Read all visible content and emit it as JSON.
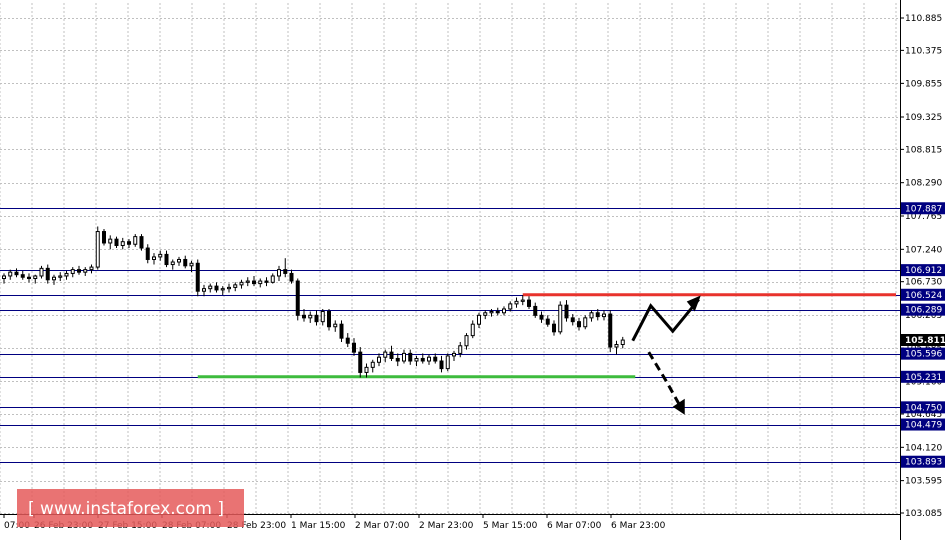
{
  "chart_data": {
    "type": "candlestick",
    "symbol_hidden": true,
    "y_axis": {
      "ticks": [
        "110.885",
        "110.375",
        "109.855",
        "109.325",
        "108.815",
        "108.290",
        "107.765",
        "107.240",
        "106.730",
        "106.205",
        "105.685",
        "105.160",
        "104.645",
        "104.120",
        "103.595",
        "103.085"
      ],
      "tick_values": [
        110.885,
        110.375,
        109.855,
        109.325,
        108.815,
        108.29,
        107.765,
        107.24,
        106.73,
        106.205,
        105.685,
        105.16,
        104.645,
        104.12,
        103.595,
        103.085
      ],
      "ylim": [
        103.085,
        110.885
      ],
      "position": "right"
    },
    "x_axis": {
      "labels": [
        "07:00",
        "26 Feb 23:00",
        "27 Feb 15:00",
        "28 Feb 07:00",
        "28 Feb 23:00",
        "1 Mar 15:00",
        "2 Mar 07:00",
        "2 Mar 23:00",
        "5 Mar 15:00",
        "6 Mar 07:00",
        "6 Mar 23:00"
      ]
    },
    "grid": true,
    "levels": [
      {
        "label": "107.887",
        "value": 107.887,
        "color": "#000080",
        "box_color": "#000080"
      },
      {
        "label": "106.912",
        "value": 106.912,
        "color": "#000080",
        "box_color": "#000080"
      },
      {
        "label": "106.524",
        "value": 106.524,
        "color": "#000080",
        "box_color": "#000080"
      },
      {
        "label": "106.289",
        "value": 106.289,
        "color": "#000080",
        "box_color": "#000080"
      },
      {
        "label": "105.596",
        "value": 105.596,
        "color": "#000080",
        "box_color": "#000080"
      },
      {
        "label": "105.231",
        "value": 105.231,
        "color": "#000080",
        "box_color": "#000080"
      },
      {
        "label": "104.750",
        "value": 104.75,
        "color": "#000080",
        "box_color": "#000080"
      },
      {
        "label": "104.479",
        "value": 104.479,
        "color": "#000080",
        "box_color": "#000080"
      },
      {
        "label": "103.893",
        "value": 103.893,
        "color": "#000080",
        "box_color": "#000080"
      }
    ],
    "current_price": {
      "label": "105.811",
      "value": 105.811,
      "box_color": "#000000"
    },
    "resistance_line": {
      "value": 106.524,
      "color": "#e8322c",
      "x_from_bar": 83,
      "x_to_end": true
    },
    "support_line": {
      "value": 105.231,
      "color": "#3dbb3d",
      "x_from_bar": 31,
      "x_to_bar": 101
    },
    "scenario_up": [
      [
        105.8,
        106.35,
        105.95,
        106.45
      ]
    ],
    "scenario_down": [
      [
        105.62,
        105.15,
        104.79
      ]
    ],
    "ohlc": [
      [
        106.78,
        106.86,
        106.7,
        106.82
      ],
      [
        106.82,
        106.92,
        106.76,
        106.88
      ],
      [
        106.88,
        106.94,
        106.8,
        106.84
      ],
      [
        106.84,
        106.9,
        106.76,
        106.8
      ],
      [
        106.8,
        106.86,
        106.72,
        106.78
      ],
      [
        106.78,
        106.84,
        106.7,
        106.82
      ],
      [
        106.82,
        106.98,
        106.78,
        106.94
      ],
      [
        106.94,
        107.0,
        106.7,
        106.76
      ],
      [
        106.76,
        106.84,
        106.68,
        106.8
      ],
      [
        106.8,
        106.88,
        106.74,
        106.82
      ],
      [
        106.82,
        106.9,
        106.76,
        106.86
      ],
      [
        106.86,
        106.96,
        106.8,
        106.92
      ],
      [
        106.92,
        106.98,
        106.84,
        106.88
      ],
      [
        106.88,
        106.96,
        106.82,
        106.92
      ],
      [
        106.92,
        107.0,
        106.86,
        106.96
      ],
      [
        106.96,
        107.6,
        106.92,
        107.52
      ],
      [
        107.52,
        107.56,
        107.3,
        107.34
      ],
      [
        107.34,
        107.46,
        107.24,
        107.4
      ],
      [
        107.4,
        107.44,
        107.26,
        107.3
      ],
      [
        107.3,
        107.42,
        107.24,
        107.36
      ],
      [
        107.36,
        107.4,
        107.26,
        107.32
      ],
      [
        107.32,
        107.48,
        107.28,
        107.44
      ],
      [
        107.44,
        107.48,
        107.22,
        107.26
      ],
      [
        107.26,
        107.32,
        107.02,
        107.08
      ],
      [
        107.08,
        107.18,
        107.0,
        107.12
      ],
      [
        107.12,
        107.22,
        107.06,
        107.16
      ],
      [
        107.16,
        107.22,
        106.96,
        107.0
      ],
      [
        107.0,
        107.08,
        106.92,
        107.04
      ],
      [
        107.04,
        107.12,
        106.98,
        107.08
      ],
      [
        107.08,
        107.14,
        106.94,
        106.98
      ],
      [
        106.98,
        107.06,
        106.88,
        107.02
      ],
      [
        107.02,
        107.08,
        106.5,
        106.58
      ],
      [
        106.58,
        106.68,
        106.5,
        106.62
      ],
      [
        106.62,
        106.7,
        106.56,
        106.66
      ],
      [
        106.66,
        106.72,
        106.56,
        106.6
      ],
      [
        106.6,
        106.66,
        106.52,
        106.62
      ],
      [
        106.62,
        106.7,
        106.56,
        106.64
      ],
      [
        106.64,
        106.72,
        106.58,
        106.68
      ],
      [
        106.68,
        106.76,
        106.62,
        106.72
      ],
      [
        106.72,
        106.8,
        106.66,
        106.74
      ],
      [
        106.74,
        106.82,
        106.66,
        106.7
      ],
      [
        106.7,
        106.78,
        106.64,
        106.74
      ],
      [
        106.74,
        106.8,
        106.66,
        106.72
      ],
      [
        106.72,
        106.86,
        106.7,
        106.82
      ],
      [
        106.82,
        106.98,
        106.74,
        106.92
      ],
      [
        106.92,
        107.1,
        106.8,
        106.86
      ],
      [
        106.86,
        106.92,
        106.7,
        106.74
      ],
      [
        106.74,
        106.78,
        106.12,
        106.2
      ],
      [
        106.2,
        106.3,
        106.1,
        106.16
      ],
      [
        106.16,
        106.26,
        106.08,
        106.2
      ],
      [
        106.2,
        106.28,
        106.04,
        106.1
      ],
      [
        106.1,
        106.3,
        106.04,
        106.26
      ],
      [
        106.26,
        106.3,
        105.96,
        106.02
      ],
      [
        106.02,
        106.12,
        105.94,
        106.06
      ],
      [
        106.06,
        106.12,
        105.78,
        105.84
      ],
      [
        105.84,
        105.92,
        105.7,
        105.76
      ],
      [
        105.76,
        105.84,
        105.56,
        105.62
      ],
      [
        105.62,
        105.7,
        105.22,
        105.3
      ],
      [
        105.3,
        105.44,
        105.22,
        105.38
      ],
      [
        105.38,
        105.5,
        105.3,
        105.46
      ],
      [
        105.46,
        105.6,
        105.4,
        105.54
      ],
      [
        105.54,
        105.66,
        105.46,
        105.62
      ],
      [
        105.62,
        105.72,
        105.48,
        105.52
      ],
      [
        105.52,
        105.6,
        105.4,
        105.48
      ],
      [
        105.48,
        105.66,
        105.44,
        105.6
      ],
      [
        105.6,
        105.66,
        105.42,
        105.48
      ],
      [
        105.48,
        105.56,
        105.4,
        105.52
      ],
      [
        105.52,
        105.6,
        105.44,
        105.48
      ],
      [
        105.48,
        105.58,
        105.42,
        105.54
      ],
      [
        105.54,
        105.6,
        105.44,
        105.48
      ],
      [
        105.48,
        105.56,
        105.3,
        105.36
      ],
      [
        105.36,
        105.6,
        105.32,
        105.56
      ],
      [
        105.56,
        105.64,
        105.48,
        105.6
      ],
      [
        105.6,
        105.78,
        105.54,
        105.72
      ],
      [
        105.72,
        105.92,
        105.66,
        105.88
      ],
      [
        105.88,
        106.12,
        105.84,
        106.06
      ],
      [
        106.06,
        106.24,
        106.0,
        106.2
      ],
      [
        106.2,
        106.28,
        106.14,
        106.24
      ],
      [
        106.24,
        106.3,
        106.18,
        106.26
      ],
      [
        106.26,
        106.32,
        106.2,
        106.24
      ],
      [
        106.24,
        106.34,
        106.2,
        106.3
      ],
      [
        106.3,
        106.42,
        106.26,
        106.38
      ],
      [
        106.38,
        106.48,
        106.32,
        106.42
      ],
      [
        106.42,
        106.52,
        106.36,
        106.44
      ],
      [
        106.44,
        106.5,
        106.3,
        106.34
      ],
      [
        106.34,
        106.4,
        106.16,
        106.2
      ],
      [
        106.2,
        106.26,
        106.08,
        106.14
      ],
      [
        106.14,
        106.2,
        106.02,
        106.06
      ],
      [
        106.06,
        106.12,
        105.88,
        105.94
      ],
      [
        105.94,
        106.42,
        105.9,
        106.36
      ],
      [
        106.36,
        106.44,
        106.1,
        106.16
      ],
      [
        106.16,
        106.22,
        106.04,
        106.1
      ],
      [
        106.1,
        106.16,
        105.96,
        106.02
      ],
      [
        106.02,
        106.2,
        105.98,
        106.16
      ],
      [
        106.16,
        106.28,
        106.1,
        106.24
      ],
      [
        106.24,
        106.3,
        106.12,
        106.18
      ],
      [
        106.18,
        106.28,
        106.12,
        106.22
      ],
      [
        106.22,
        106.28,
        105.62,
        105.7
      ],
      [
        105.7,
        105.8,
        105.58,
        105.74
      ],
      [
        105.74,
        105.86,
        105.68,
        105.81
      ]
    ]
  },
  "watermark": {
    "text": "[  www.instaforex.com  ]",
    "bg_color": "#e55a5a"
  }
}
